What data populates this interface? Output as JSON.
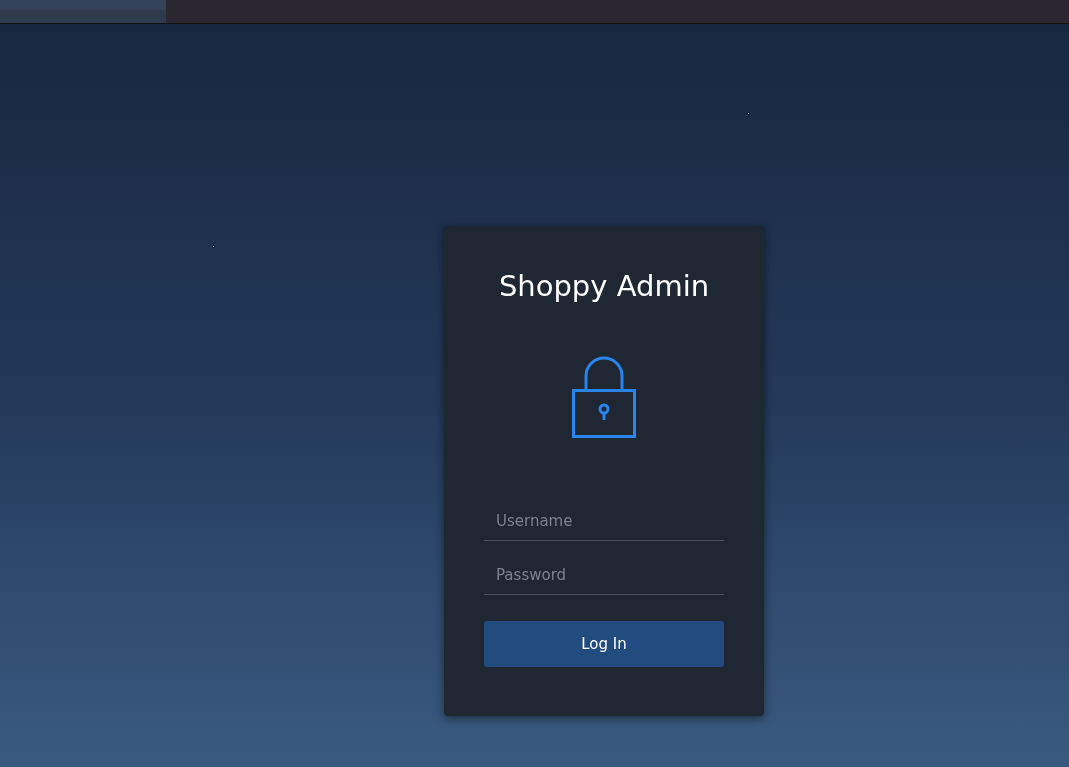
{
  "login": {
    "title": "Shoppy Admin",
    "fields": [
      {
        "placeholder": "Username"
      },
      {
        "placeholder": "Password"
      }
    ],
    "submit": "Log In"
  }
}
